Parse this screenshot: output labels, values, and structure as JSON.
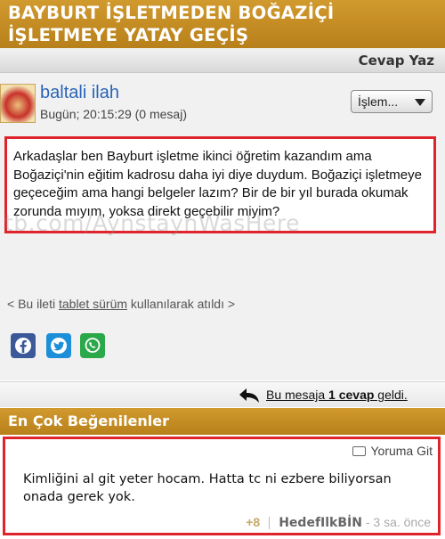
{
  "topic": {
    "title": "BAYBURT İŞLETMEDEN BOĞAZİÇİ İŞLETMEYE YATAY GEÇİŞ"
  },
  "toolbar": {
    "reply_label": "Cevap Yaz"
  },
  "post": {
    "username": "baltali ilah",
    "timestamp": "Bugün; 20:15:29 (0 mesaj)",
    "action_button": "İşlem...",
    "body": "Arkadaşlar ben Bayburt işletme ikinci öğretim kazandım ama Boğaziçi'nin eğitim kadrosu daha iyi diye duydum. Boğaziçi işletmeye geçeceğim ama hangi belgeler lazım? Bir de bir yıl burada okumak zorunda mıyım, yoksa direkt geçebilir miyim?",
    "watermark": "tb.com/AynstaynWasHere",
    "tablet_prefix": "< Bu ileti ",
    "tablet_link": "tablet sürüm",
    "tablet_suffix": " kullanılarak atıldı >"
  },
  "share": [
    {
      "name": "facebook-icon",
      "color": "#3b5998"
    },
    {
      "name": "twitter-icon",
      "color": "#1d8fd8"
    },
    {
      "name": "whatsapp-icon",
      "color": "#2aa84a"
    }
  ],
  "replies": {
    "prefix": "Bu mesaja ",
    "count": "1 cevap",
    "suffix": " geldi."
  },
  "best": {
    "title": "En Çok Beğenilenler",
    "goto_label": "Yoruma Git",
    "comment": "Kimliğini al git yeter hocam. Hatta tc ni ezbere biliyorsan onada gerek yok.",
    "likes": "+8",
    "author": "HedefIlkBİN",
    "time_ago": " - 3 sa. önce"
  },
  "colors": {
    "accent": "#c48c22",
    "highlight": "#e0242c",
    "username": "#2a64b8"
  }
}
